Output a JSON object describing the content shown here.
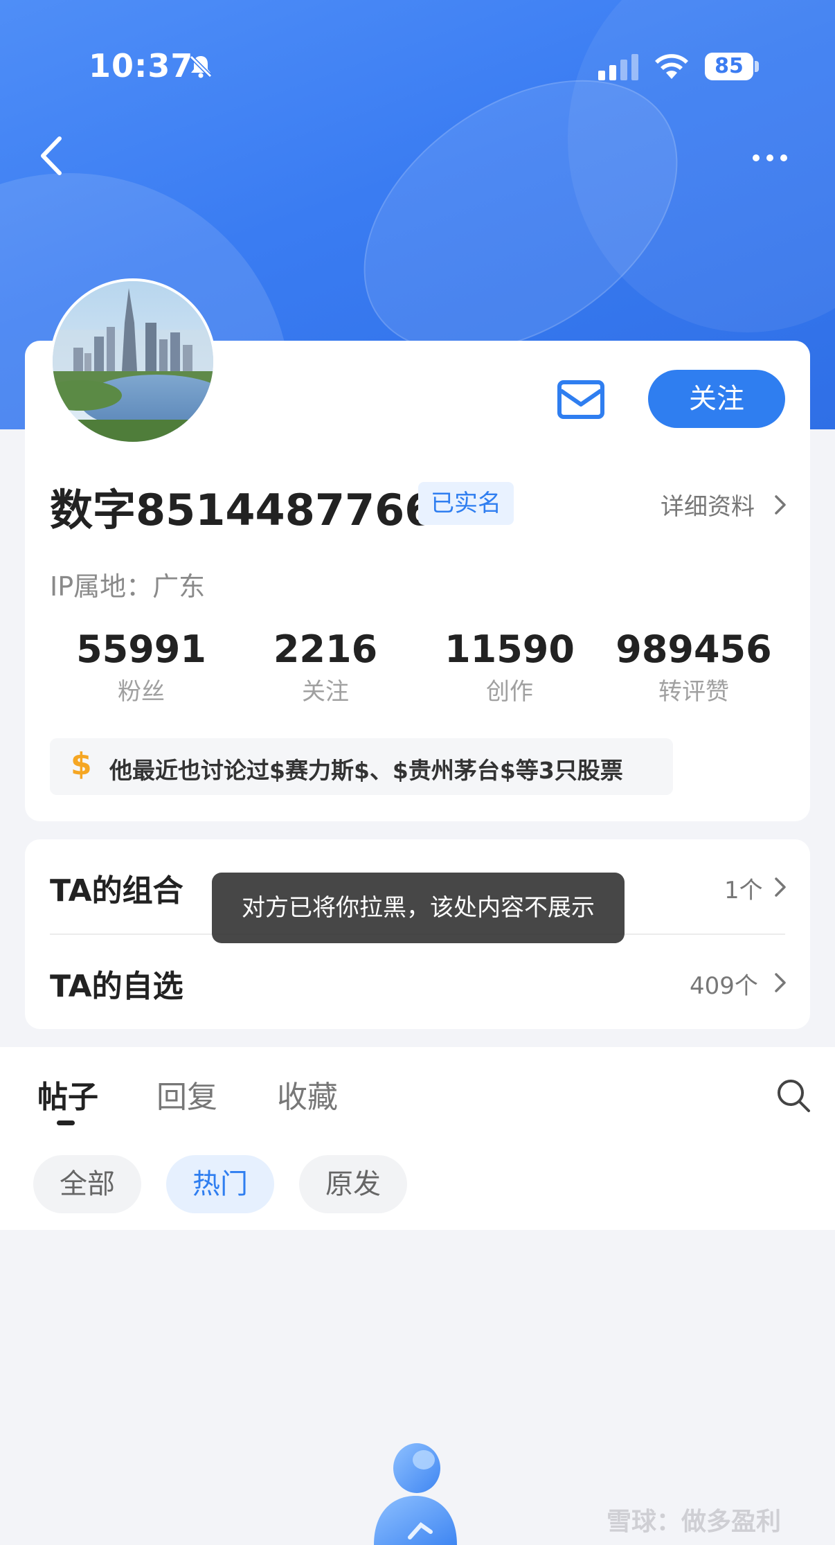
{
  "status_bar": {
    "time": "10:37",
    "battery": "85"
  },
  "profile": {
    "username": "数字8514487766",
    "verified_badge": "已实名",
    "details_link": "详细资料",
    "ip_location": "IP属地：广东",
    "follow_button": "关注",
    "stats": [
      {
        "value": "55991",
        "label": "粉丝"
      },
      {
        "value": "2216",
        "label": "关注"
      },
      {
        "value": "11590",
        "label": "创作"
      },
      {
        "value": "989456",
        "label": "转评赞"
      }
    ],
    "stock_note": {
      "icon": "$",
      "text": "他最近也讨论过$赛力斯$、$贵州茅台$等3只股票"
    }
  },
  "lists": {
    "portfolio": {
      "title": "TA的组合",
      "count": "1个"
    },
    "watchlist": {
      "title": "TA的自选",
      "count": "409个"
    }
  },
  "toast": "对方已将你拉黑，该处内容不展示",
  "tabs": [
    {
      "label": "帖子",
      "active": true
    },
    {
      "label": "回复",
      "active": false
    },
    {
      "label": "收藏",
      "active": false
    }
  ],
  "filters": [
    {
      "label": "全部",
      "active": false
    },
    {
      "label": "热门",
      "active": true
    },
    {
      "label": "原发",
      "active": false
    }
  ],
  "watermark": "雪球：做多盈利",
  "colors": {
    "brand_blue": "#2f7ef0",
    "header_gradient_start": "#4f8ef7",
    "header_gradient_end": "#2f6fe6",
    "accent_gold": "#f5a623"
  }
}
